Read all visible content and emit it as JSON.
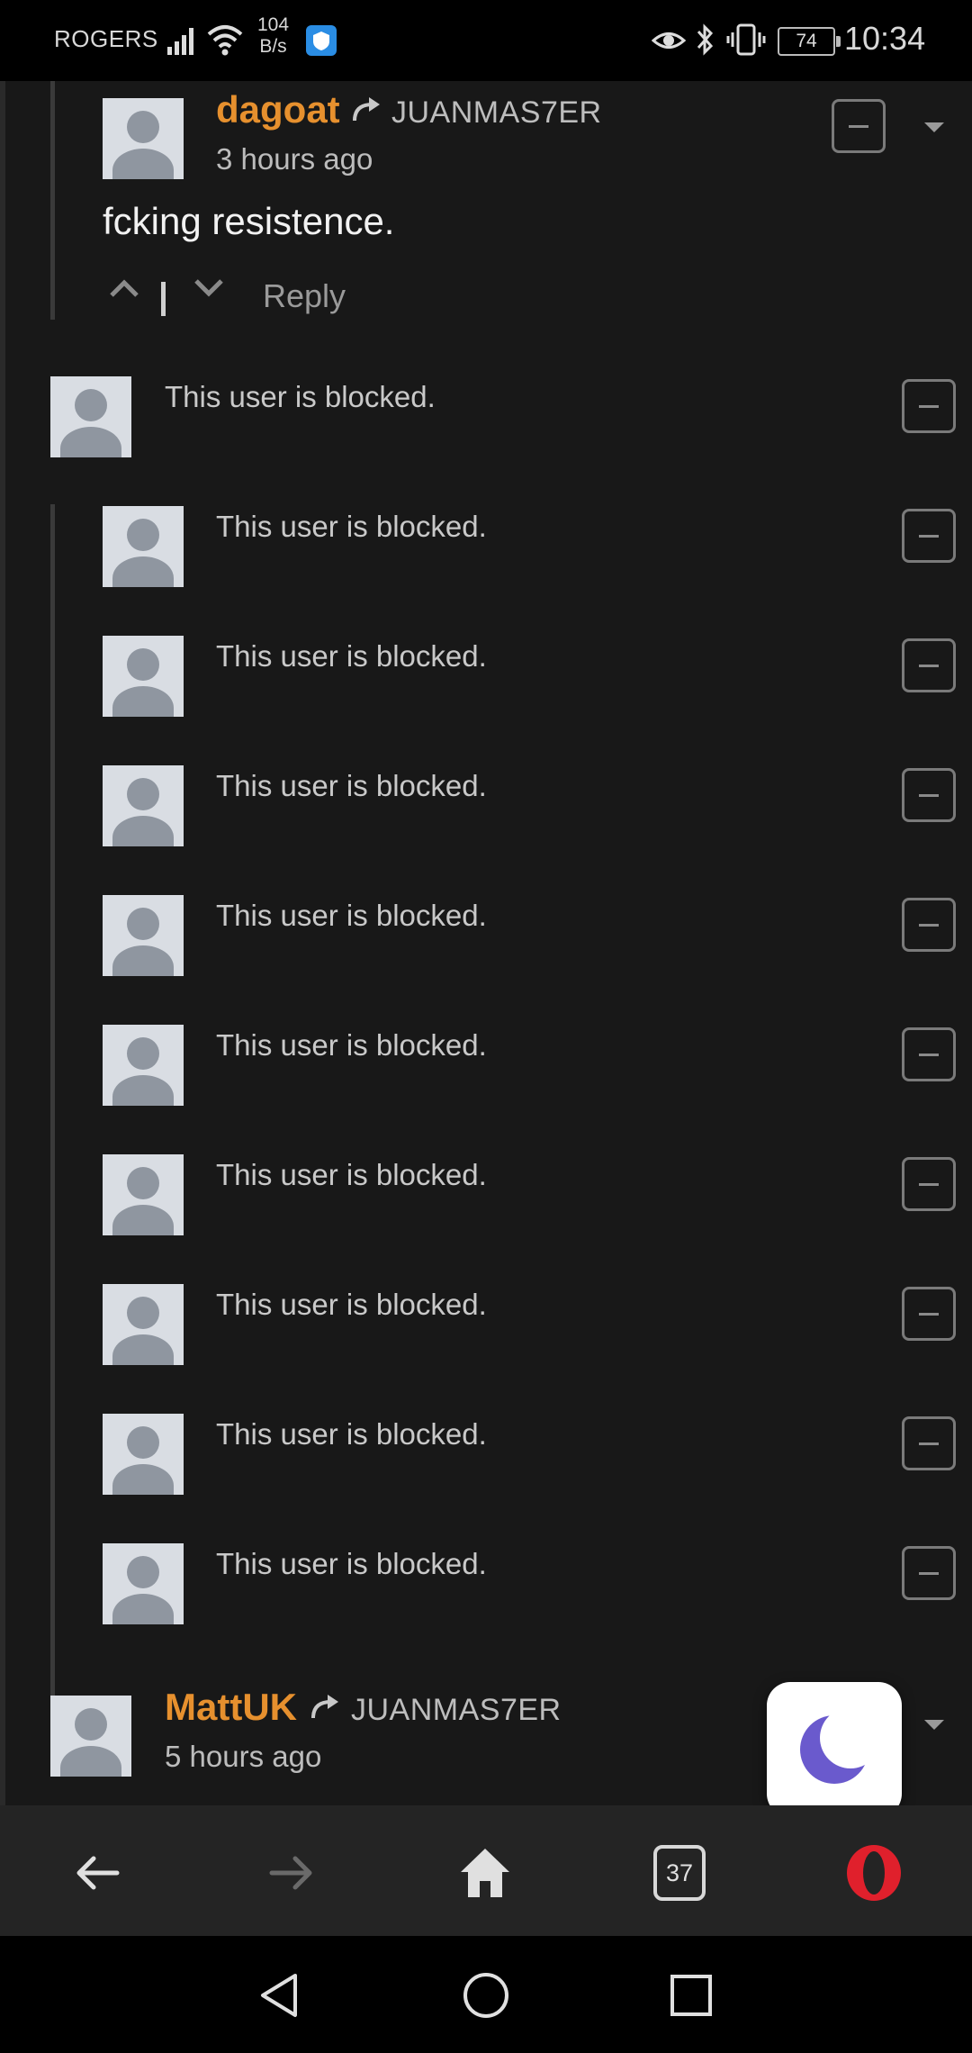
{
  "status_bar": {
    "carrier": "ROGERS",
    "speed_value": "104",
    "speed_unit": "B/s",
    "battery": "74",
    "time": "10:34",
    "icons": [
      "signal-icon",
      "wifi-icon",
      "vpn-shield-icon",
      "eye-comfort-icon",
      "bluetooth-icon",
      "vibrate-icon",
      "battery-icon"
    ]
  },
  "comments": {
    "top": {
      "username": "dagoat",
      "reply_to": "JUANMAS7ER",
      "time": "3 hours ago",
      "text": "fcking resistence.",
      "reply_label": "Reply"
    },
    "blocked_parent": {
      "text": "This user is blocked."
    },
    "blocked_replies": [
      {
        "text": "This user is blocked."
      },
      {
        "text": "This user is blocked."
      },
      {
        "text": "This user is blocked."
      },
      {
        "text": "This user is blocked."
      },
      {
        "text": "This user is blocked."
      },
      {
        "text": "This user is blocked."
      },
      {
        "text": "This user is blocked."
      },
      {
        "text": "This user is blocked."
      },
      {
        "text": "This user is blocked."
      }
    ],
    "bottom": {
      "username": "MattUK",
      "reply_to": "JUANMAS7ER",
      "time": "5 hours ago"
    }
  },
  "night_mode_button": {
    "icon": "moon-icon",
    "color": "#6a5acd"
  },
  "browser_bar": {
    "tabs_count": "37",
    "icons": [
      "back-arrow-icon",
      "forward-arrow-icon",
      "home-icon",
      "tabs-icon",
      "opera-menu-icon"
    ],
    "opera_color": "#e0202c"
  },
  "android_nav": {
    "icons": [
      "nav-back-icon",
      "nav-home-icon",
      "nav-recents-icon"
    ]
  },
  "colors": {
    "background": "#181818",
    "username": "#e6902e",
    "text": "#f2f2f2"
  }
}
